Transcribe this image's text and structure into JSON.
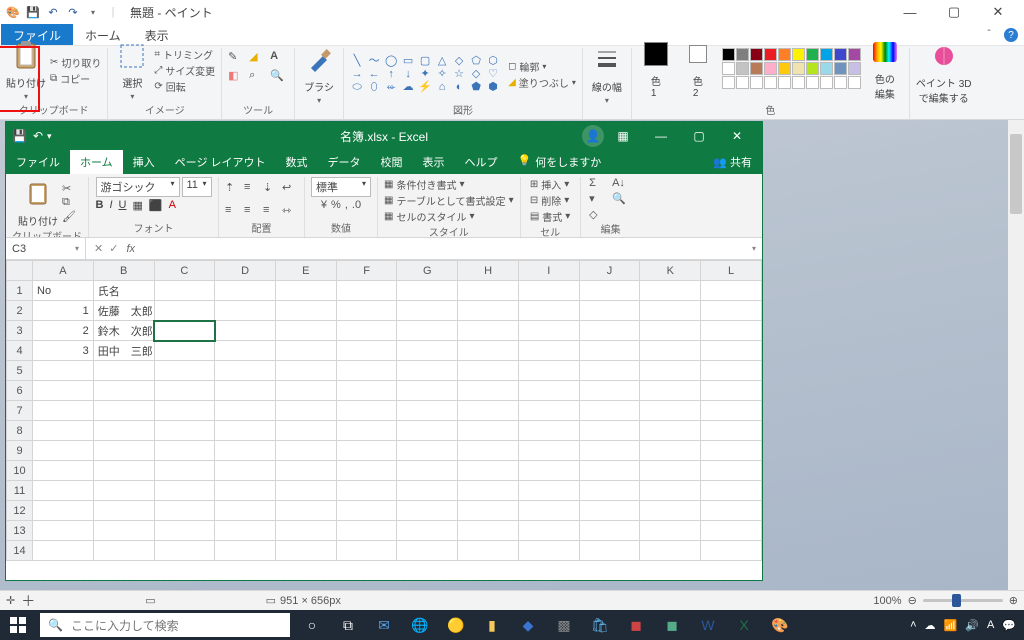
{
  "paint": {
    "title": "無題 - ペイント",
    "tabs": {
      "file": "ファイル",
      "home": "ホーム",
      "view": "表示"
    },
    "groups": {
      "clipboard": {
        "label": "クリップボード",
        "paste": "貼り付け",
        "cut": "切り取り",
        "copy": "コピー"
      },
      "image": {
        "label": "イメージ",
        "select": "選択",
        "trim": "トリミング",
        "resize": "サイズ変更",
        "rotate": "回転"
      },
      "tools": {
        "label": "ツール"
      },
      "brush": {
        "label": "ブラシ",
        "brush": "ブラシ"
      },
      "shapes": {
        "label": "図形",
        "outline": "輪郭",
        "fill": "塗りつぶし"
      },
      "linewidth": {
        "label": "線の幅",
        "cap": "線の幅"
      },
      "colors": {
        "label": "色",
        "c1": "色\n1",
        "c2": "色\n2",
        "edit": "色の\n編集"
      },
      "p3d": {
        "cap": "ペイント 3D\nで編集する"
      }
    },
    "status": {
      "dims": "951 × 656px",
      "zoom": "100%",
      "plus": "＋"
    },
    "palette_row1": [
      "#000",
      "#7f7f7f",
      "#880015",
      "#ed1c24",
      "#ff7f27",
      "#fff200",
      "#22b14c",
      "#00a2e8",
      "#3f48cc",
      "#a349a4"
    ],
    "palette_row2": [
      "#fff",
      "#c3c3c3",
      "#b97a57",
      "#ffaec9",
      "#ffc90e",
      "#efe4b0",
      "#b5e61d",
      "#99d9ea",
      "#7092be",
      "#c8bfe7"
    ],
    "palette_row3": [
      "#fff",
      "#fff",
      "#fff",
      "#fff",
      "#fff",
      "#fff",
      "#fff",
      "#fff",
      "#fff",
      "#fff"
    ]
  },
  "excel": {
    "title": "名簿.xlsx  -  Excel",
    "share": "共有",
    "tell_me": "何をしますか",
    "tabs": [
      "ファイル",
      "ホーム",
      "挿入",
      "ページ レイアウト",
      "数式",
      "データ",
      "校閲",
      "表示",
      "ヘルプ"
    ],
    "ribbon": {
      "clipboard": {
        "label": "クリップボード",
        "paste": "貼り付け"
      },
      "font": {
        "label": "フォント",
        "name": "游ゴシック",
        "size": "11"
      },
      "align": {
        "label": "配置"
      },
      "number": {
        "label": "数値",
        "format": "標準"
      },
      "styles": {
        "label": "スタイル",
        "cond": "条件付き書式",
        "tbl": "テーブルとして書式設定",
        "cell": "セルのスタイル"
      },
      "cells": {
        "label": "セル",
        "insert": "挿入",
        "delete": "削除",
        "format": "書式"
      },
      "editing": {
        "label": "編集"
      }
    },
    "namebox": "C3",
    "columns": [
      "A",
      "B",
      "C",
      "D",
      "E",
      "F",
      "G",
      "H",
      "I",
      "J",
      "K",
      "L"
    ],
    "sheet": {
      "headers": {
        "A1": "No",
        "B1": "氏名"
      },
      "rows": [
        {
          "n": "1",
          "name": "佐藤　太郎"
        },
        {
          "n": "2",
          "name": "鈴木　次郎"
        },
        {
          "n": "3",
          "name": "田中　三郎"
        }
      ]
    }
  },
  "taskbar": {
    "search_placeholder": "ここに入力して検索",
    "tray_ime": "A"
  }
}
